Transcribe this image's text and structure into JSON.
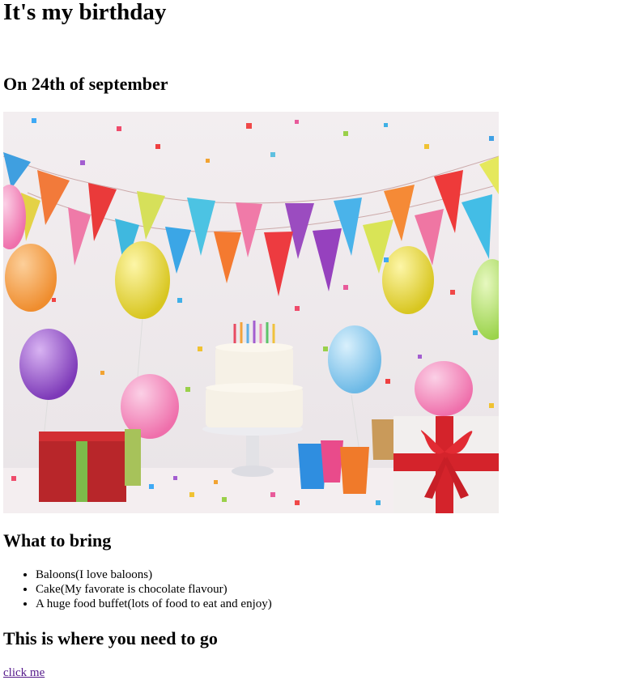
{
  "page": {
    "title": "It's my birthday",
    "date_heading": "On 24th of september",
    "image": {
      "alt": "",
      "subject": "birthday-party-scene"
    },
    "bring_heading": "What to bring",
    "bring_items": [
      "Baloons(I love baloons)",
      "Cake(My favorate is chocolate flavour)",
      "A huge food buffet(lots of food to eat and enjoy)"
    ],
    "directions_heading": "This is where you need to go",
    "link_text": "click me",
    "link_color": "#551a8b"
  }
}
